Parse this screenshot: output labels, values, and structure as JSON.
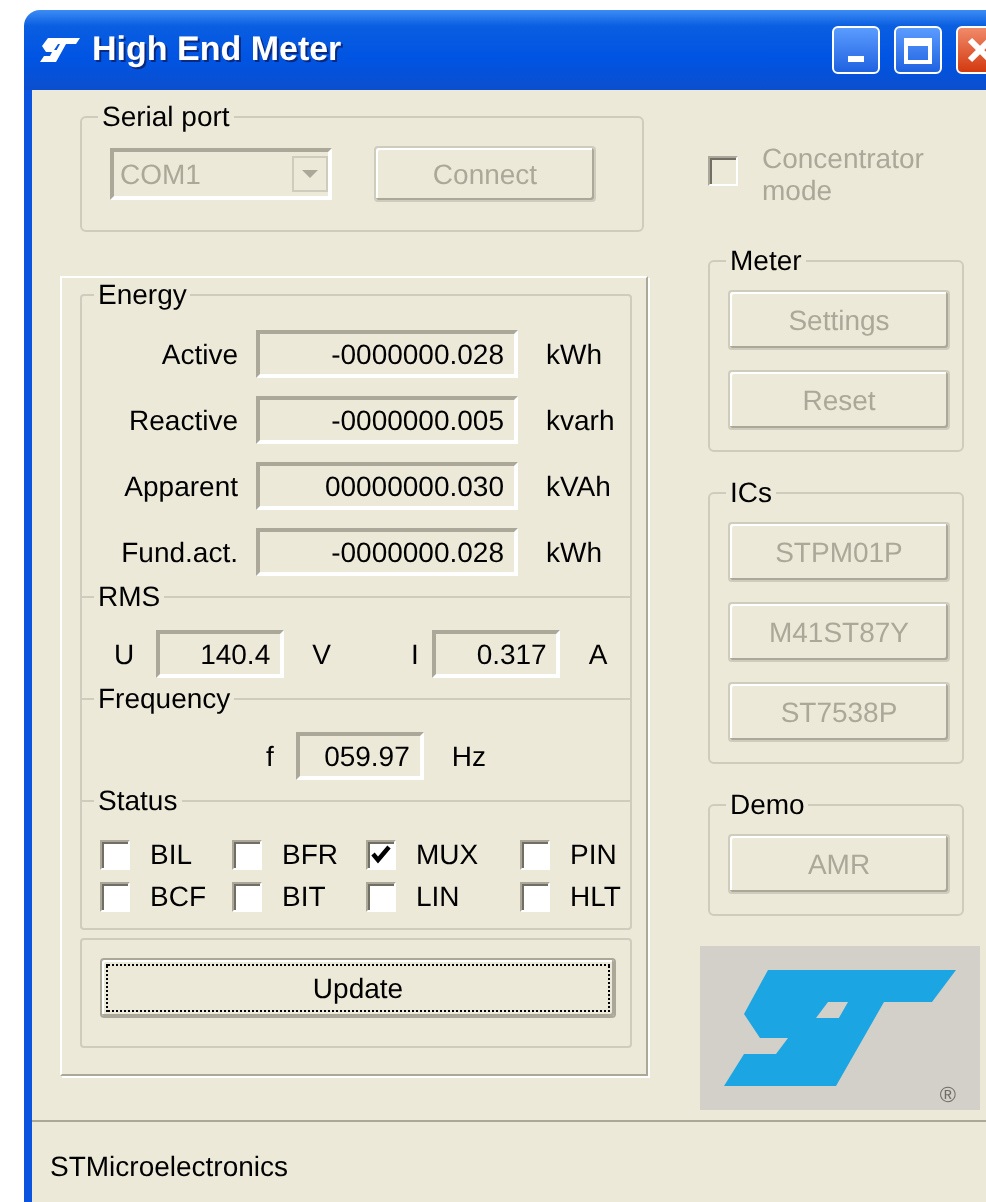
{
  "window": {
    "title": "High End Meter"
  },
  "serial_port": {
    "title": "Serial port",
    "port": {
      "value": "COM1",
      "disabled": true
    },
    "connect_button": {
      "label": "Connect",
      "disabled": true
    }
  },
  "concentrator_mode": {
    "label": "Concentrator mode",
    "checked": false,
    "disabled": true
  },
  "energy": {
    "title": "Energy",
    "rows": [
      {
        "label": "Active",
        "value": "-0000000.028",
        "unit": "kWh"
      },
      {
        "label": "Reactive",
        "value": "-0000000.005",
        "unit": "kvarh"
      },
      {
        "label": "Apparent",
        "value": "00000000.030",
        "unit": "kVAh"
      },
      {
        "label": "Fund.act.",
        "value": "-0000000.028",
        "unit": "kWh"
      }
    ]
  },
  "rms": {
    "title": "RMS",
    "readings": [
      {
        "label": "U",
        "value": "140.4",
        "unit": "V"
      },
      {
        "label": "I",
        "value": "0.317",
        "unit": "A"
      }
    ]
  },
  "frequency": {
    "title": "Frequency",
    "readings": [
      {
        "label": "f",
        "value": "059.97",
        "unit": "Hz"
      }
    ]
  },
  "status": {
    "title": "Status",
    "flags": [
      {
        "label": "BIL",
        "checked": false
      },
      {
        "label": "BFR",
        "checked": false
      },
      {
        "label": "MUX",
        "checked": true
      },
      {
        "label": "PIN",
        "checked": false
      },
      {
        "label": "BCF",
        "checked": false
      },
      {
        "label": "BIT",
        "checked": false
      },
      {
        "label": "LIN",
        "checked": false
      },
      {
        "label": "HLT",
        "checked": false
      }
    ]
  },
  "update_button": {
    "label": "Update",
    "focused": true
  },
  "groups": [
    {
      "title": "Meter",
      "buttons": [
        {
          "label": "Settings",
          "disabled": true
        },
        {
          "label": "Reset",
          "disabled": true
        }
      ]
    },
    {
      "title": "ICs",
      "buttons": [
        {
          "label": "STPM01P",
          "disabled": true
        },
        {
          "label": "M41ST87Y",
          "disabled": true
        },
        {
          "label": "ST7538P",
          "disabled": true
        }
      ]
    },
    {
      "title": "Demo",
      "buttons": [
        {
          "label": "AMR",
          "disabled": true
        }
      ]
    }
  ],
  "logo": {
    "registered_mark": "®"
  },
  "status_bar": {
    "text": "STMicroelectronics"
  }
}
